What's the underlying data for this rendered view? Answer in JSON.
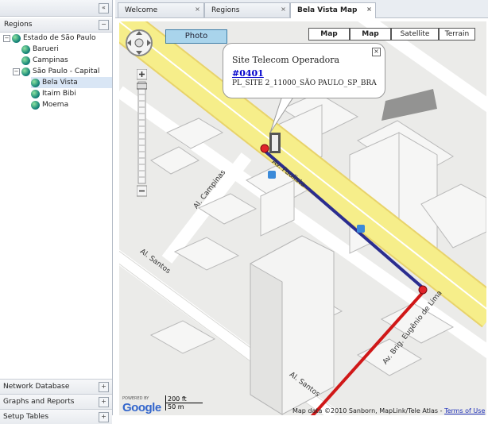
{
  "left_panel": {
    "collapse_glyph": "«",
    "regions_header": "Regions",
    "regions_toggle": "−",
    "tree": [
      {
        "label": "Estado de São Paulo",
        "toggle": "−"
      },
      {
        "label": "Barueri"
      },
      {
        "label": "Campinas"
      },
      {
        "label": "São Paulo - Capital",
        "toggle": "−"
      },
      {
        "label": "Bela Vista",
        "selected": true
      },
      {
        "label": "Itaim Bibi"
      },
      {
        "label": "Moema"
      }
    ],
    "bottom_panels": [
      {
        "label": "Network Database",
        "toggle": "+"
      },
      {
        "label": "Graphs and Reports",
        "toggle": "+"
      },
      {
        "label": "Setup Tables",
        "toggle": "+"
      }
    ]
  },
  "tabs": [
    {
      "label": "Welcome",
      "close": "×"
    },
    {
      "label": "Regions",
      "close": "×"
    },
    {
      "label": "Bela Vista Map",
      "close": "×",
      "active": true
    }
  ],
  "map": {
    "photo_button": "Photo",
    "map_types": [
      "Map",
      "Map",
      "Satellite",
      "Terrain"
    ],
    "popup": {
      "title": "Site Telecom Operadora",
      "link": "#0401",
      "site_id": "PL_SITE 2_11000_SÃO PAULO_SP_BRA",
      "close": "×"
    },
    "streets": {
      "paulista": "Av. Paulista",
      "campinas": "Al. Campinas",
      "santos1": "Al. Santos",
      "santos2": "Al. Santos",
      "eugenio": "Av. Brig. Eugênio de Lima"
    },
    "scale": {
      "ft": "200 ft",
      "m": "50 m"
    },
    "logo": {
      "powered_by": "POWERED BY",
      "name": "Google"
    },
    "copyright": "Map data ©2010 Sanborn, MapLink/Tele Atlas -",
    "terms": "Terms of Use",
    "colors": {
      "route_blue": "#2b2d8f",
      "route_red": "#d01818",
      "avenue_yellow": "#f6ee8a"
    }
  }
}
